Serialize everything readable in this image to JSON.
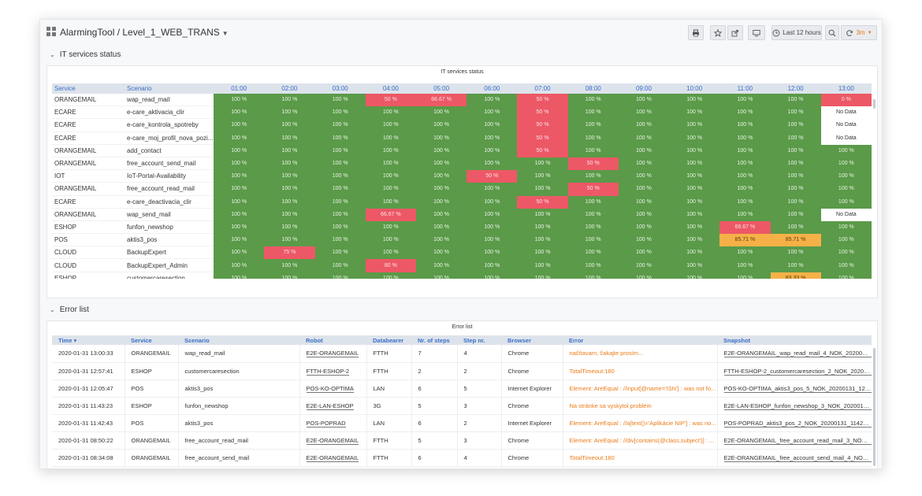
{
  "navbar": {
    "title": "AlarmingTool / Level_1_WEB_TRANS",
    "time_range": "Last 12 hours",
    "refresh": "3m"
  },
  "row1": {
    "title": "IT services status"
  },
  "status_panel": {
    "title": "IT services status",
    "headers": [
      "Service",
      "Scenario",
      "01:00",
      "02:00",
      "03:00",
      "04:00",
      "05:00",
      "06:00",
      "07:00",
      "08:00",
      "09:00",
      "10:00",
      "11:00",
      "12:00",
      "13:00"
    ],
    "rows": [
      {
        "service": "ORANGEMAIL",
        "scenario": "wap_read_mail",
        "cells": [
          "100 %",
          "100 %",
          "100 %",
          "50 %",
          "66.67 %",
          "100 %",
          "50 %",
          "100 %",
          "100 %",
          "100 %",
          "100 %",
          "100 %",
          "0 %"
        ]
      },
      {
        "service": "ECARE",
        "scenario": "e-care_aktivacia_clir",
        "cells": [
          "100 %",
          "100 %",
          "100 %",
          "100 %",
          "100 %",
          "100 %",
          "50 %",
          "100 %",
          "100 %",
          "100 %",
          "100 %",
          "100 %",
          "No Data"
        ]
      },
      {
        "service": "ECARE",
        "scenario": "e-care_kontrola_spotreby",
        "cells": [
          "100 %",
          "100 %",
          "100 %",
          "100 %",
          "100 %",
          "100 %",
          "50 %",
          "100 %",
          "100 %",
          "100 %",
          "100 %",
          "100 %",
          "No Data"
        ]
      },
      {
        "service": "ECARE",
        "scenario": "e-care_moj_profil_nova_pozi...",
        "cells": [
          "100 %",
          "100 %",
          "100 %",
          "100 %",
          "100 %",
          "100 %",
          "50 %",
          "100 %",
          "100 %",
          "100 %",
          "100 %",
          "100 %",
          "No Data"
        ]
      },
      {
        "service": "ORANGEMAIL",
        "scenario": "add_contact",
        "cells": [
          "100 %",
          "100 %",
          "100 %",
          "100 %",
          "100 %",
          "100 %",
          "50 %",
          "100 %",
          "100 %",
          "100 %",
          "100 %",
          "100 %",
          "100 %"
        ]
      },
      {
        "service": "ORANGEMAIL",
        "scenario": "free_account_send_mail",
        "cells": [
          "100 %",
          "100 %",
          "100 %",
          "100 %",
          "100 %",
          "100 %",
          "100 %",
          "50 %",
          "100 %",
          "100 %",
          "100 %",
          "100 %",
          "100 %"
        ]
      },
      {
        "service": "IOT",
        "scenario": "IoT-Portal-Availability",
        "cells": [
          "100 %",
          "100 %",
          "100 %",
          "100 %",
          "100 %",
          "50 %",
          "100 %",
          "100 %",
          "100 %",
          "100 %",
          "100 %",
          "100 %",
          "100 %"
        ]
      },
      {
        "service": "ORANGEMAIL",
        "scenario": "free_account_read_mail",
        "cells": [
          "100 %",
          "100 %",
          "100 %",
          "100 %",
          "100 %",
          "100 %",
          "100 %",
          "50 %",
          "100 %",
          "100 %",
          "100 %",
          "100 %",
          "100 %"
        ]
      },
      {
        "service": "ECARE",
        "scenario": "e-care_deactivacia_clir",
        "cells": [
          "100 %",
          "100 %",
          "100 %",
          "100 %",
          "100 %",
          "100 %",
          "50 %",
          "100 %",
          "100 %",
          "100 %",
          "100 %",
          "100 %",
          "100 %"
        ]
      },
      {
        "service": "ORANGEMAIL",
        "scenario": "wap_send_mail",
        "cells": [
          "100 %",
          "100 %",
          "100 %",
          "66.67 %",
          "100 %",
          "100 %",
          "100 %",
          "100 %",
          "100 %",
          "100 %",
          "100 %",
          "100 %",
          "No Data"
        ]
      },
      {
        "service": "ESHOP",
        "scenario": "funfon_newshop",
        "cells": [
          "100 %",
          "100 %",
          "100 %",
          "100 %",
          "100 %",
          "100 %",
          "100 %",
          "100 %",
          "100 %",
          "100 %",
          "66.67 %",
          "100 %",
          "100 %"
        ]
      },
      {
        "service": "POS",
        "scenario": "aktis3_pos",
        "cells": [
          "100 %",
          "100 %",
          "100 %",
          "100 %",
          "100 %",
          "100 %",
          "100 %",
          "100 %",
          "100 %",
          "100 %",
          "85.71 %",
          "85.71 %",
          "100 %"
        ]
      },
      {
        "service": "CLOUD",
        "scenario": "BackupExpert",
        "cells": [
          "100 %",
          "75 %",
          "100 %",
          "100 %",
          "100 %",
          "100 %",
          "100 %",
          "100 %",
          "100 %",
          "100 %",
          "100 %",
          "100 %",
          "100 %"
        ]
      },
      {
        "service": "CLOUD",
        "scenario": "BackupExpert_Admin",
        "cells": [
          "100 %",
          "100 %",
          "100 %",
          "80 %",
          "100 %",
          "100 %",
          "100 %",
          "100 %",
          "100 %",
          "100 %",
          "100 %",
          "100 %",
          "100 %"
        ]
      },
      {
        "service": "ESHOP",
        "scenario": "customercaresection",
        "cells": [
          "100 %",
          "100 %",
          "100 %",
          "100 %",
          "100 %",
          "100 %",
          "100 %",
          "100 %",
          "100 %",
          "100 %",
          "100 %",
          "83.33 %",
          "100 %"
        ]
      }
    ]
  },
  "row2": {
    "title": "Error list"
  },
  "error_panel": {
    "title": "Error list",
    "headers": [
      "Time",
      "Service",
      "Scenario",
      "Robot",
      "Databearer",
      "Nr. of steps",
      "Step nr.",
      "Browser",
      "Error",
      "Snapshot"
    ],
    "rows": [
      {
        "time": "2020-01-31 13:00:33",
        "service": "ORANGEMAIL",
        "scenario": "wap_read_mail",
        "robot": "E2E-ORANGEMAIL",
        "databearer": "FTTH",
        "steps": "7",
        "step": "4",
        "browser": "Chrome",
        "error": "načítavam, čakajte prosím...",
        "snapshot": "E2E-ORANGEMAIL_wap_read_mail_4_NOK_20200131..."
      },
      {
        "time": "2020-01-31 12:57:41",
        "service": "ESHOP",
        "scenario": "customercaresection",
        "robot": "FTTH-ESHOP-2",
        "databearer": "FTTH",
        "steps": "2",
        "step": "2",
        "browser": "Chrome",
        "error": "TotalTimeout:180",
        "snapshot": "FTTH-ESHOP-2_customercaresection_2_NOK_202001..."
      },
      {
        "time": "2020-01-31 12:05:47",
        "service": "POS",
        "scenario": "aktis3_pos",
        "robot": "POS-KO-OPTIMA",
        "databearer": "LAN",
        "steps": "6",
        "step": "5",
        "browser": "Internet Explorer",
        "error": "Element: AreEqual : //input[@name='ISN'] : was not fo...",
        "snapshot": "POS-KO-OPTIMA_aktis3_pos_5_NOK_20200131_1206..."
      },
      {
        "time": "2020-01-31 11:43:23",
        "service": "ESHOP",
        "scenario": "funfon_newshop",
        "robot": "E2E-LAN-ESHOP",
        "databearer": "3G",
        "steps": "5",
        "step": "3",
        "browser": "Chrome",
        "error": "Na stránke sa vyskytol problém",
        "snapshot": "E2E-LAN-ESHOP_funfon_newshop_3_NOK_20200131_..."
      },
      {
        "time": "2020-01-31 11:42:43",
        "service": "POS",
        "scenario": "aktis3_pos",
        "robot": "POS-POPRAD",
        "databearer": "LAN",
        "steps": "6",
        "step": "2",
        "browser": "Internet Explorer",
        "error": "Element: AreEqual : //a[text()='Aplikácie NIP'] : was no...",
        "snapshot": "POS-POPRAD_aktis3_pos_2_NOK_20200131_114255.j..."
      },
      {
        "time": "2020-01-31 08:50:22",
        "service": "ORANGEMAIL",
        "scenario": "free_account_read_mail",
        "robot": "E2E-ORANGEMAIL",
        "databearer": "FTTH",
        "steps": "5",
        "step": "3",
        "browser": "Chrome",
        "error": "Element: AreEqual : //div[contains(@class,subject')] : ...",
        "snapshot": "E2E-ORANGEMAIL_free_account_read_mail_3_NOK_2..."
      },
      {
        "time": "2020-01-31 08:34:08",
        "service": "ORANGEMAIL",
        "scenario": "free_account_send_mail",
        "robot": "E2E-ORANGEMAIL",
        "databearer": "FTTH",
        "steps": "6",
        "step": "4",
        "browser": "Chrome",
        "error": "TotalTimeout:180",
        "snapshot": "E2E-ORANGEMAIL_free_account_send_mail_4_NOK_2..."
      }
    ]
  },
  "colors": {
    "ok": "#5a9a48",
    "bad": "#ed5866",
    "warn": "#f5b147",
    "header_text": "#3a6fc8",
    "error_text": "#eb7b18"
  },
  "icons": [
    "dashboard-grid-icon",
    "print-icon",
    "star-icon",
    "share-icon",
    "tv-icon",
    "clock-icon",
    "zoom-out-icon",
    "refresh-icon"
  ]
}
